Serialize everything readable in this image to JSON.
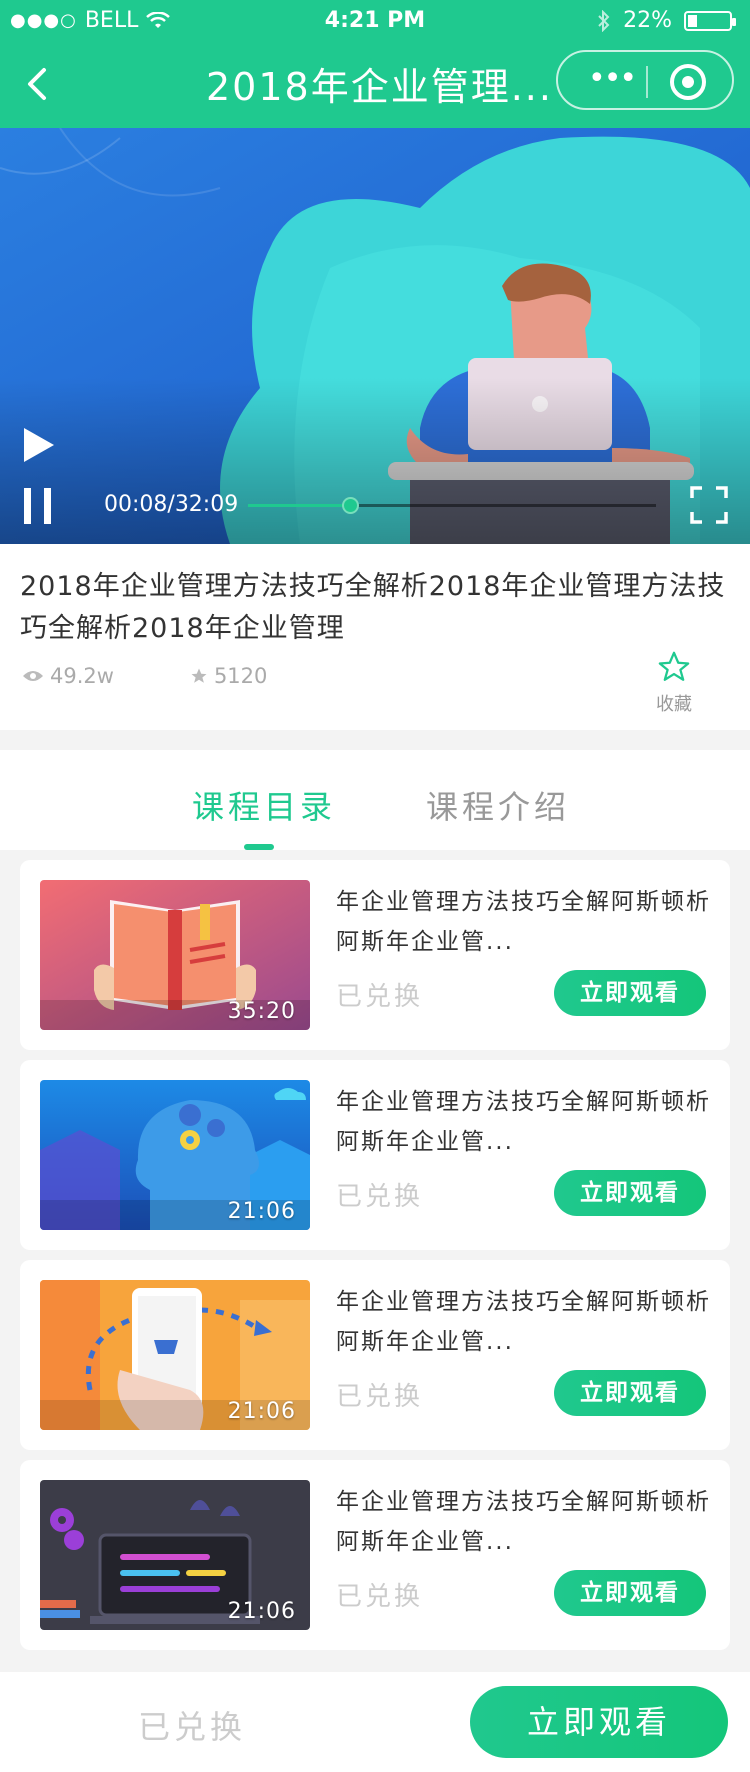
{
  "status_bar": {
    "carrier": "BELL",
    "time": "4:21 PM",
    "battery": "22%",
    "battery_level": 0.22
  },
  "nav": {
    "title": "2018年企业管理...",
    "back_icon": "chevron-left-icon",
    "more_icon": "more-dots-icon",
    "close_icon": "target-icon"
  },
  "player": {
    "current_time": "00:08",
    "total_time": "32:09",
    "time_text": "00:08/32:09",
    "progress": 0.25,
    "play_icon": "play-icon",
    "pause_icon": "pause-icon",
    "fullscreen_icon": "fullscreen-icon"
  },
  "course": {
    "title": "2018年企业管理方法技巧全解析2018年企业管理方法技巧全解析2018年企业管理",
    "views": "49.2w",
    "stars": "5120",
    "favorite_label": "收藏"
  },
  "tabs": [
    {
      "label": "课程目录",
      "active": true
    },
    {
      "label": "课程介绍",
      "active": false
    }
  ],
  "lessons": [
    {
      "title": "年企业管理方法技巧全解阿斯顿析阿斯年企业管...",
      "duration": "35:20",
      "status": "已兑换",
      "button": "立即观看",
      "thumb": "book-illustration"
    },
    {
      "title": "年企业管理方法技巧全解阿斯顿析阿斯年企业管...",
      "duration": "21:06",
      "status": "已兑换",
      "button": "立即观看",
      "thumb": "head-gears-illustration"
    },
    {
      "title": "年企业管理方法技巧全解阿斯顿析阿斯年企业管...",
      "duration": "21:06",
      "status": "已兑换",
      "button": "立即观看",
      "thumb": "phone-coffee-illustration"
    },
    {
      "title": "年企业管理方法技巧全解阿斯顿析阿斯年企业管...",
      "duration": "21:06",
      "status": "已兑换",
      "button": "立即观看",
      "thumb": "laptop-code-illustration"
    }
  ],
  "bottom_bar": {
    "status": "已兑换",
    "button": "立即观看"
  },
  "colors": {
    "brand": "#1fc98f",
    "muted": "#cccccc",
    "text": "#333333"
  }
}
